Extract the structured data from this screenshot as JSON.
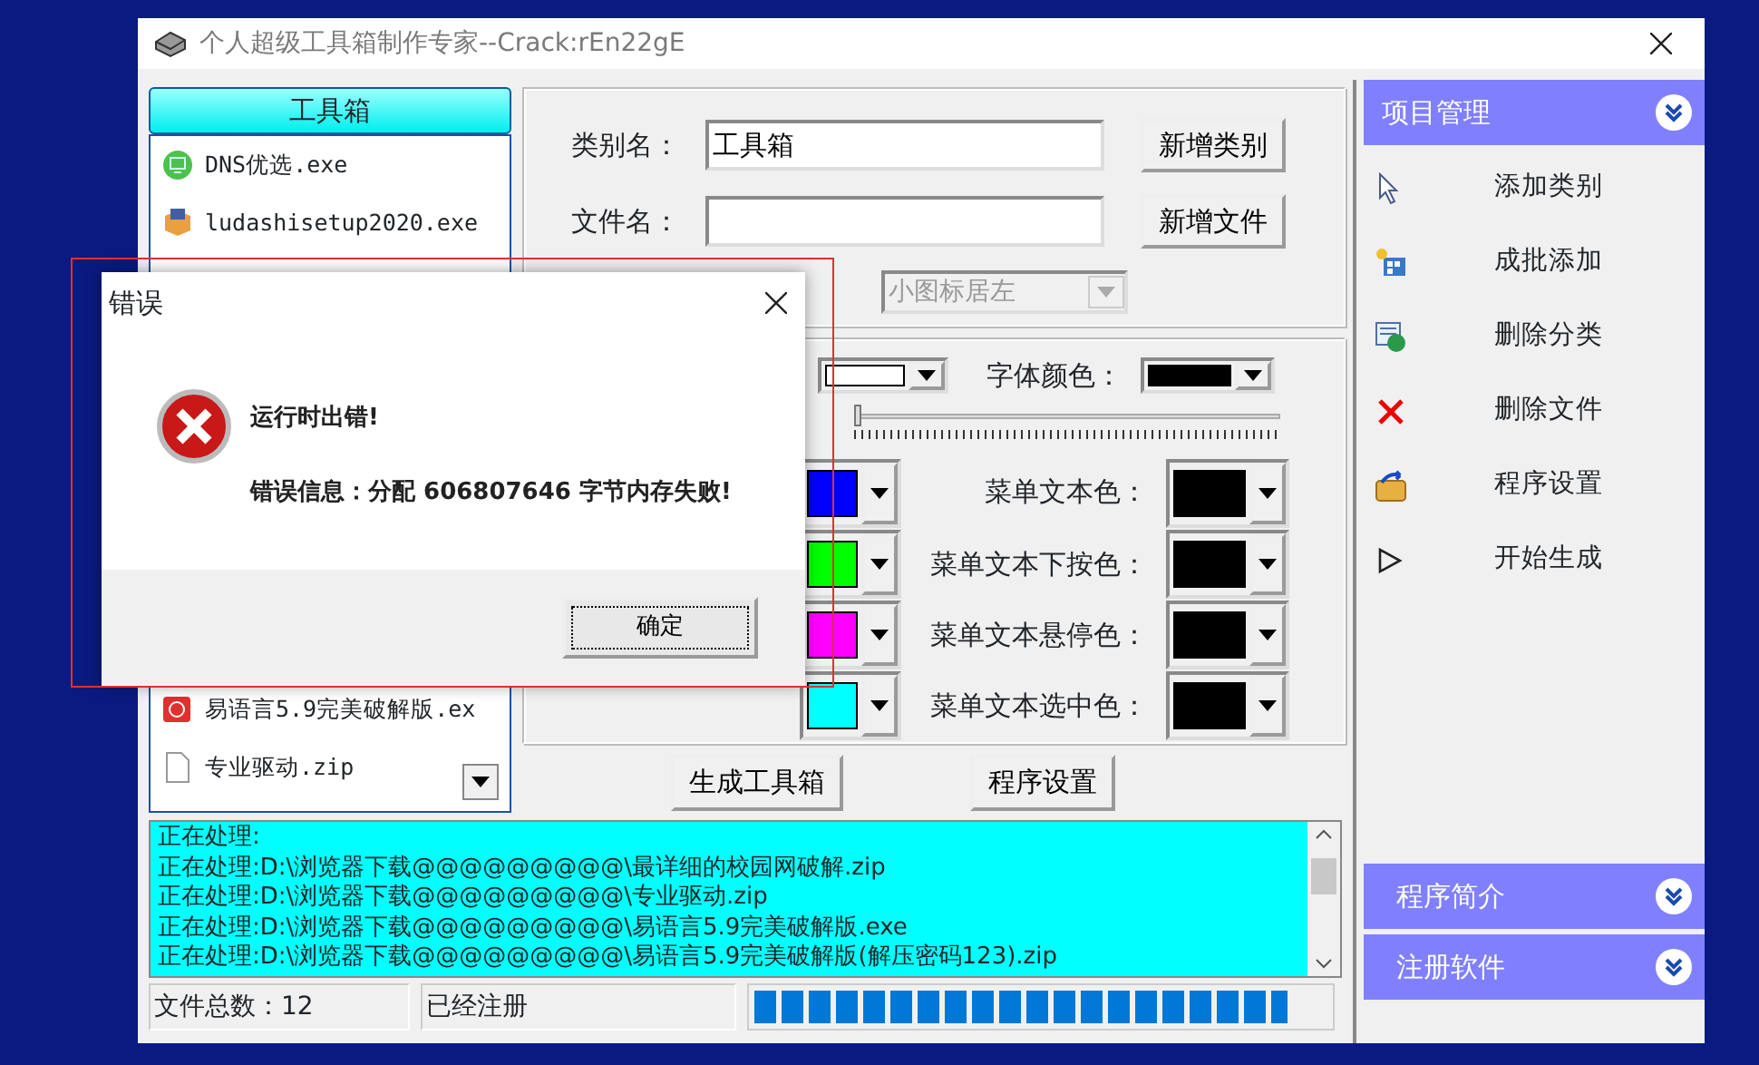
{
  "window": {
    "title": "个人超级工具箱制作专家--Crack:rEn22gE"
  },
  "toolbox_list": {
    "header": "工具箱",
    "items": [
      {
        "name": "DNS优选.exe",
        "kind": "green-app"
      },
      {
        "name": "ludashisetup2020.exe",
        "kind": "installer"
      },
      {
        "name": "易语言5.9完美破解版.ex",
        "kind": "red-app"
      },
      {
        "name": "专业驱动.zip",
        "kind": "file"
      }
    ]
  },
  "category_form": {
    "category_label": "类别名：",
    "category_value": "工具箱",
    "add_category_button": "新增类别",
    "file_label": "文件名：",
    "add_file_button": "新增文件",
    "display_mode": {
      "value": "小图标居左",
      "disabled": true
    }
  },
  "color_settings": {
    "rows": [
      {
        "left_swatch": {
          "color": "#ffffff"
        },
        "label": "字体颜色：",
        "right_swatch": {
          "color": "#000000"
        },
        "kind": "small"
      },
      {
        "kind": "slider",
        "level": 0
      },
      {
        "left_swatch": {
          "color": "#0000ff"
        },
        "label": "菜单文本色：",
        "right_swatch": {
          "color": "#000000"
        },
        "kind": "large"
      },
      {
        "left_swatch": {
          "color": "#00ff00"
        },
        "label": "菜单文本下按色：",
        "right_swatch": {
          "color": "#000000"
        },
        "kind": "large"
      },
      {
        "left_swatch": {
          "color": "#ff00ff"
        },
        "label": "菜单文本悬停色：",
        "right_swatch": {
          "color": "#000000"
        },
        "kind": "large"
      },
      {
        "left_swatch": {
          "color": "#00ffff"
        },
        "label": "菜单文本选中色：",
        "right_swatch": {
          "color": "#000000"
        },
        "kind": "large"
      }
    ]
  },
  "buttons": [
    "生成工具箱",
    "程序设置"
  ],
  "log": {
    "lines": [
      "正在处理:",
      "正在处理:D:\\浏览器下载@@@@@@@@@\\最详细的校园网破解.zip",
      "正在处理:D:\\浏览器下载@@@@@@@@@\\专业驱动.zip",
      "正在处理:D:\\浏览器下载@@@@@@@@@\\易语言5.9完美破解版.exe",
      "正在处理:D:\\浏览器下载@@@@@@@@@\\易语言5.9完美破解版(解压密码123).zip"
    ]
  },
  "status_bar": {
    "file_count": "文件总数：12",
    "registration": "已经注册",
    "progress": {
      "level": 0.93
    }
  },
  "sidebar": {
    "sections": [
      {
        "title": "项目管理",
        "expanded": true,
        "items": [
          {
            "label": "添加类别",
            "kind": "pointer"
          },
          {
            "label": "成批添加",
            "kind": "windows"
          },
          {
            "label": "删除分类",
            "kind": "globe-doc"
          },
          {
            "label": "删除文件",
            "kind": "cross"
          },
          {
            "label": "程序设置",
            "kind": "folder"
          },
          {
            "label": "开始生成",
            "kind": "play"
          }
        ]
      },
      {
        "title": "程序简介",
        "expanded": false
      },
      {
        "title": "注册软件",
        "expanded": false
      }
    ]
  },
  "dialog": {
    "title": "错误",
    "heading": "运行时出错!",
    "message": "错误信息：分配 606807646 字节内存失败!",
    "ok_button": "确定"
  }
}
